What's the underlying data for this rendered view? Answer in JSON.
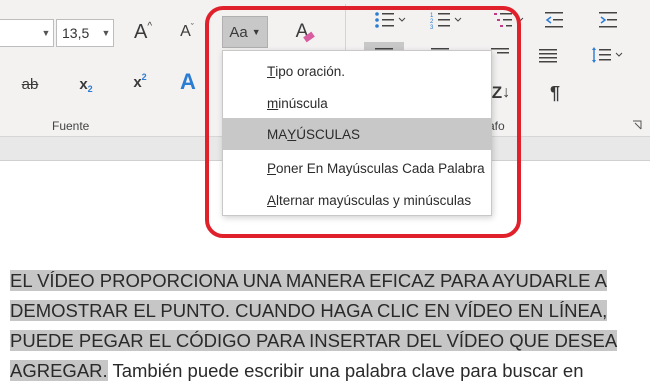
{
  "ribbon": {
    "font_size": "13,5",
    "change_case_label": "Aa",
    "font_group_label": "Fuente",
    "paragraph_group_label": "afo",
    "subscript_label": "x",
    "subscript_sub": "2",
    "superscript_label": "x",
    "superscript_sup": "2",
    "strikethrough_label": "ab",
    "grow_font_label": "A",
    "shrink_font_label": "A",
    "clear_format_label": "A",
    "text_effects_label": "A",
    "sort_label": "Z",
    "pilcrow_label": "¶"
  },
  "menu": {
    "items": [
      {
        "pre": "",
        "ul": "T",
        "post": "ipo oración."
      },
      {
        "pre": "",
        "ul": "m",
        "post": "inúscula"
      },
      {
        "pre": "MA",
        "ul": "Y",
        "post": "ÚSCULAS"
      },
      {
        "pre": "",
        "ul": "P",
        "post": "oner En Mayúsculas Cada Palabra"
      },
      {
        "pre": "",
        "ul": "A",
        "post": "lternar mayúsculas y minúsculas"
      }
    ]
  },
  "document": {
    "lines": [
      "EL VÍDEO PROPORCIONA UNA MANERA EFICAZ PARA AYUDARLE A",
      "DEMOSTRAR EL PUNTO. CUANDO HAGA CLIC EN VÍDEO EN LÍNEA,",
      "PUEDE PEGAR EL CÓDIGO PARA INSERTAR DEL VÍDEO QUE DESEA"
    ],
    "last_line_highlighted": "AGREGAR.",
    "last_line_rest": " También puede escribir una palabra clave para buscar en"
  },
  "colors": {
    "highlight_ring": "#e0212b",
    "text_highlight": "#c6c6c6",
    "selected_menu_item": "#c8c8c8",
    "text_effects_blue": "#2b7cd3"
  }
}
